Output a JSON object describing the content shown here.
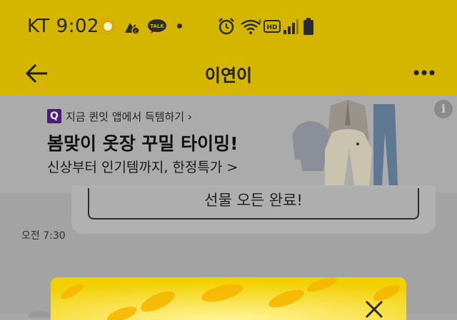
{
  "status_bar": {
    "carrier_time": "KT 9:02",
    "icons": [
      "weather-sun-icon",
      "camera-icon",
      "kakaotalk-icon",
      "alarm-icon",
      "wifi-icon",
      "hd-icon",
      "signal-icon",
      "battery-icon"
    ],
    "talk_label": "TALK",
    "hd_label": "HD",
    "wifi_label": "6"
  },
  "header": {
    "title": "이연이",
    "back_icon": "arrow-left-icon",
    "more_icon": "more-dots-icon"
  },
  "ad": {
    "logo_letter": "Q",
    "caption": "지금 퀸잇 앱에서 득템하기 ›",
    "headline": "봄맞이 옷장 꾸밀 타이밍!",
    "subline": "신상부터 인기템까지, 한정특가 >",
    "info_label": "i"
  },
  "chat": {
    "gift_button": "선물 오든 완료!",
    "timestamp": "오전 7:30"
  },
  "popup": {
    "close_icon": "close-x-icon"
  },
  "colors": {
    "header_yellow": "#d4b600",
    "popup_yellow": "#f0d000"
  }
}
